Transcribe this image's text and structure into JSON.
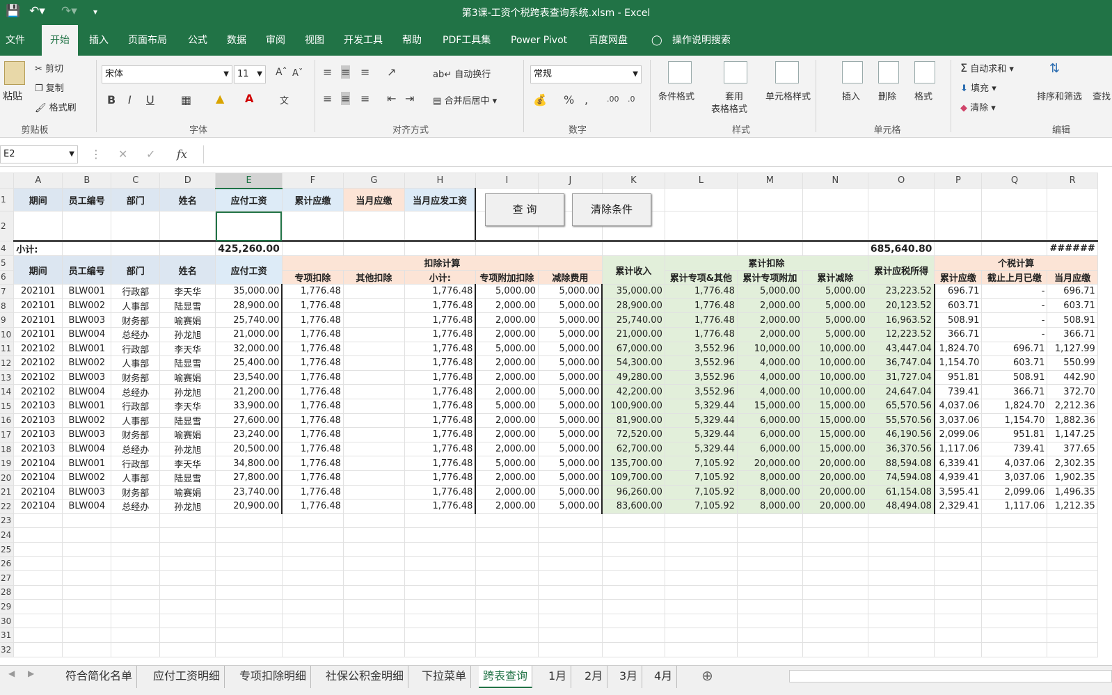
{
  "window": {
    "title": "第3课-工资个税跨表查询系统.xlsm  -  Excel"
  },
  "ribbon_tabs": [
    "文件",
    "开始",
    "插入",
    "页面布局",
    "公式",
    "数据",
    "审阅",
    "视图",
    "开发工具",
    "帮助",
    "PDF工具集",
    "Power Pivot",
    "百度网盘",
    "操作说明搜索"
  ],
  "ribbon": {
    "paste": "粘贴",
    "cut": "剪切",
    "copy": "复制",
    "format_painter": "格式刷",
    "clipboard": "剪贴板",
    "font_name": "宋体",
    "font_size": "11",
    "font_group": "字体",
    "wrap": "自动换行",
    "merge": "合并后居中",
    "align_group": "对齐方式",
    "number_format": "常规",
    "number_group": "数字",
    "cond_format": "条件格式",
    "table_format_1": "套用",
    "table_format_2": "表格格式",
    "cell_style": "单元格样式",
    "styles_group": "样式",
    "insert": "插入",
    "delete": "删除",
    "format": "格式",
    "cells_group": "单元格",
    "autosum": "自动求和",
    "fill": "填充",
    "clear": "清除",
    "sort_filter": "排序和筛选",
    "find": "查找",
    "edit_group": "编辑"
  },
  "name_box": "E2",
  "columns": [
    "A",
    "B",
    "C",
    "D",
    "E",
    "F",
    "G",
    "H",
    "I",
    "J",
    "K",
    "L",
    "M",
    "N",
    "O",
    "P",
    "Q",
    "R"
  ],
  "query_headers": [
    "期间",
    "员工编号",
    "部门",
    "姓名",
    "应付工资",
    "累计应缴",
    "当月应缴",
    "当月应发工资"
  ],
  "buttons": {
    "query": "查 询",
    "clear": "清除条件"
  },
  "subtotal": {
    "label": "小计:",
    "e": "425,260.00",
    "o": "685,640.80",
    "r": "######"
  },
  "group_headers": {
    "deduct": "扣除计算",
    "cum_deduct": "累计扣除",
    "tax": "个税计算"
  },
  "detail_headers": [
    "期间",
    "员工编号",
    "部门",
    "姓名",
    "应付工资",
    "专项扣除",
    "其他扣除",
    "小计:",
    "专项附加扣除",
    "减除费用",
    "累计收入",
    "累计专项&其他",
    "累计专项附加",
    "累计减除",
    "累计应税所得",
    "累计应缴",
    "截止上月已缴",
    "当月应缴"
  ],
  "row_numbers": [
    "1",
    "2",
    "4",
    "5",
    "6",
    "7",
    "8",
    "9",
    "10",
    "11",
    "12",
    "13",
    "14",
    "15",
    "16",
    "17",
    "18",
    "19",
    "20",
    "21",
    "22",
    "23",
    "24",
    "25",
    "26",
    "27",
    "28",
    "29",
    "30",
    "31",
    "32"
  ],
  "rows": [
    [
      "202101",
      "BLW001",
      "行政部",
      "李天华",
      "35,000.00",
      "1,776.48",
      "",
      "1,776.48",
      "5,000.00",
      "5,000.00",
      "35,000.00",
      "1,776.48",
      "5,000.00",
      "5,000.00",
      "23,223.52",
      "696.71",
      "-",
      "696.71"
    ],
    [
      "202101",
      "BLW002",
      "人事部",
      "陆显雪",
      "28,900.00",
      "1,776.48",
      "",
      "1,776.48",
      "2,000.00",
      "5,000.00",
      "28,900.00",
      "1,776.48",
      "2,000.00",
      "5,000.00",
      "20,123.52",
      "603.71",
      "-",
      "603.71"
    ],
    [
      "202101",
      "BLW003",
      "财务部",
      "喻赛娟",
      "25,740.00",
      "1,776.48",
      "",
      "1,776.48",
      "2,000.00",
      "5,000.00",
      "25,740.00",
      "1,776.48",
      "2,000.00",
      "5,000.00",
      "16,963.52",
      "508.91",
      "-",
      "508.91"
    ],
    [
      "202101",
      "BLW004",
      "总经办",
      "孙龙旭",
      "21,000.00",
      "1,776.48",
      "",
      "1,776.48",
      "2,000.00",
      "5,000.00",
      "21,000.00",
      "1,776.48",
      "2,000.00",
      "5,000.00",
      "12,223.52",
      "366.71",
      "-",
      "366.71"
    ],
    [
      "202102",
      "BLW001",
      "行政部",
      "李天华",
      "32,000.00",
      "1,776.48",
      "",
      "1,776.48",
      "5,000.00",
      "5,000.00",
      "67,000.00",
      "3,552.96",
      "10,000.00",
      "10,000.00",
      "43,447.04",
      "1,824.70",
      "696.71",
      "1,127.99"
    ],
    [
      "202102",
      "BLW002",
      "人事部",
      "陆显雪",
      "25,400.00",
      "1,776.48",
      "",
      "1,776.48",
      "2,000.00",
      "5,000.00",
      "54,300.00",
      "3,552.96",
      "4,000.00",
      "10,000.00",
      "36,747.04",
      "1,154.70",
      "603.71",
      "550.99"
    ],
    [
      "202102",
      "BLW003",
      "财务部",
      "喻赛娟",
      "23,540.00",
      "1,776.48",
      "",
      "1,776.48",
      "2,000.00",
      "5,000.00",
      "49,280.00",
      "3,552.96",
      "4,000.00",
      "10,000.00",
      "31,727.04",
      "951.81",
      "508.91",
      "442.90"
    ],
    [
      "202102",
      "BLW004",
      "总经办",
      "孙龙旭",
      "21,200.00",
      "1,776.48",
      "",
      "1,776.48",
      "2,000.00",
      "5,000.00",
      "42,200.00",
      "3,552.96",
      "4,000.00",
      "10,000.00",
      "24,647.04",
      "739.41",
      "366.71",
      "372.70"
    ],
    [
      "202103",
      "BLW001",
      "行政部",
      "李天华",
      "33,900.00",
      "1,776.48",
      "",
      "1,776.48",
      "5,000.00",
      "5,000.00",
      "100,900.00",
      "5,329.44",
      "15,000.00",
      "15,000.00",
      "65,570.56",
      "4,037.06",
      "1,824.70",
      "2,212.36"
    ],
    [
      "202103",
      "BLW002",
      "人事部",
      "陆显雪",
      "27,600.00",
      "1,776.48",
      "",
      "1,776.48",
      "2,000.00",
      "5,000.00",
      "81,900.00",
      "5,329.44",
      "6,000.00",
      "15,000.00",
      "55,570.56",
      "3,037.06",
      "1,154.70",
      "1,882.36"
    ],
    [
      "202103",
      "BLW003",
      "财务部",
      "喻赛娟",
      "23,240.00",
      "1,776.48",
      "",
      "1,776.48",
      "2,000.00",
      "5,000.00",
      "72,520.00",
      "5,329.44",
      "6,000.00",
      "15,000.00",
      "46,190.56",
      "2,099.06",
      "951.81",
      "1,147.25"
    ],
    [
      "202103",
      "BLW004",
      "总经办",
      "孙龙旭",
      "20,500.00",
      "1,776.48",
      "",
      "1,776.48",
      "2,000.00",
      "5,000.00",
      "62,700.00",
      "5,329.44",
      "6,000.00",
      "15,000.00",
      "36,370.56",
      "1,117.06",
      "739.41",
      "377.65"
    ],
    [
      "202104",
      "BLW001",
      "行政部",
      "李天华",
      "34,800.00",
      "1,776.48",
      "",
      "1,776.48",
      "5,000.00",
      "5,000.00",
      "135,700.00",
      "7,105.92",
      "20,000.00",
      "20,000.00",
      "88,594.08",
      "6,339.41",
      "4,037.06",
      "2,302.35"
    ],
    [
      "202104",
      "BLW002",
      "人事部",
      "陆显雪",
      "27,800.00",
      "1,776.48",
      "",
      "1,776.48",
      "2,000.00",
      "5,000.00",
      "109,700.00",
      "7,105.92",
      "8,000.00",
      "20,000.00",
      "74,594.08",
      "4,939.41",
      "3,037.06",
      "1,902.35"
    ],
    [
      "202104",
      "BLW003",
      "财务部",
      "喻赛娟",
      "23,740.00",
      "1,776.48",
      "",
      "1,776.48",
      "2,000.00",
      "5,000.00",
      "96,260.00",
      "7,105.92",
      "8,000.00",
      "20,000.00",
      "61,154.08",
      "3,595.41",
      "2,099.06",
      "1,496.35"
    ],
    [
      "202104",
      "BLW004",
      "总经办",
      "孙龙旭",
      "20,900.00",
      "1,776.48",
      "",
      "1,776.48",
      "2,000.00",
      "5,000.00",
      "83,600.00",
      "7,105.92",
      "8,000.00",
      "20,000.00",
      "48,494.08",
      "2,329.41",
      "1,117.06",
      "1,212.35"
    ]
  ],
  "sheet_tabs": [
    "符合简化名单",
    "应付工资明细",
    "专项扣除明细",
    "社保公积金明细",
    "下拉菜单",
    "跨表查询",
    "1月",
    "2月",
    "3月",
    "4月"
  ],
  "active_sheet": "跨表查询"
}
